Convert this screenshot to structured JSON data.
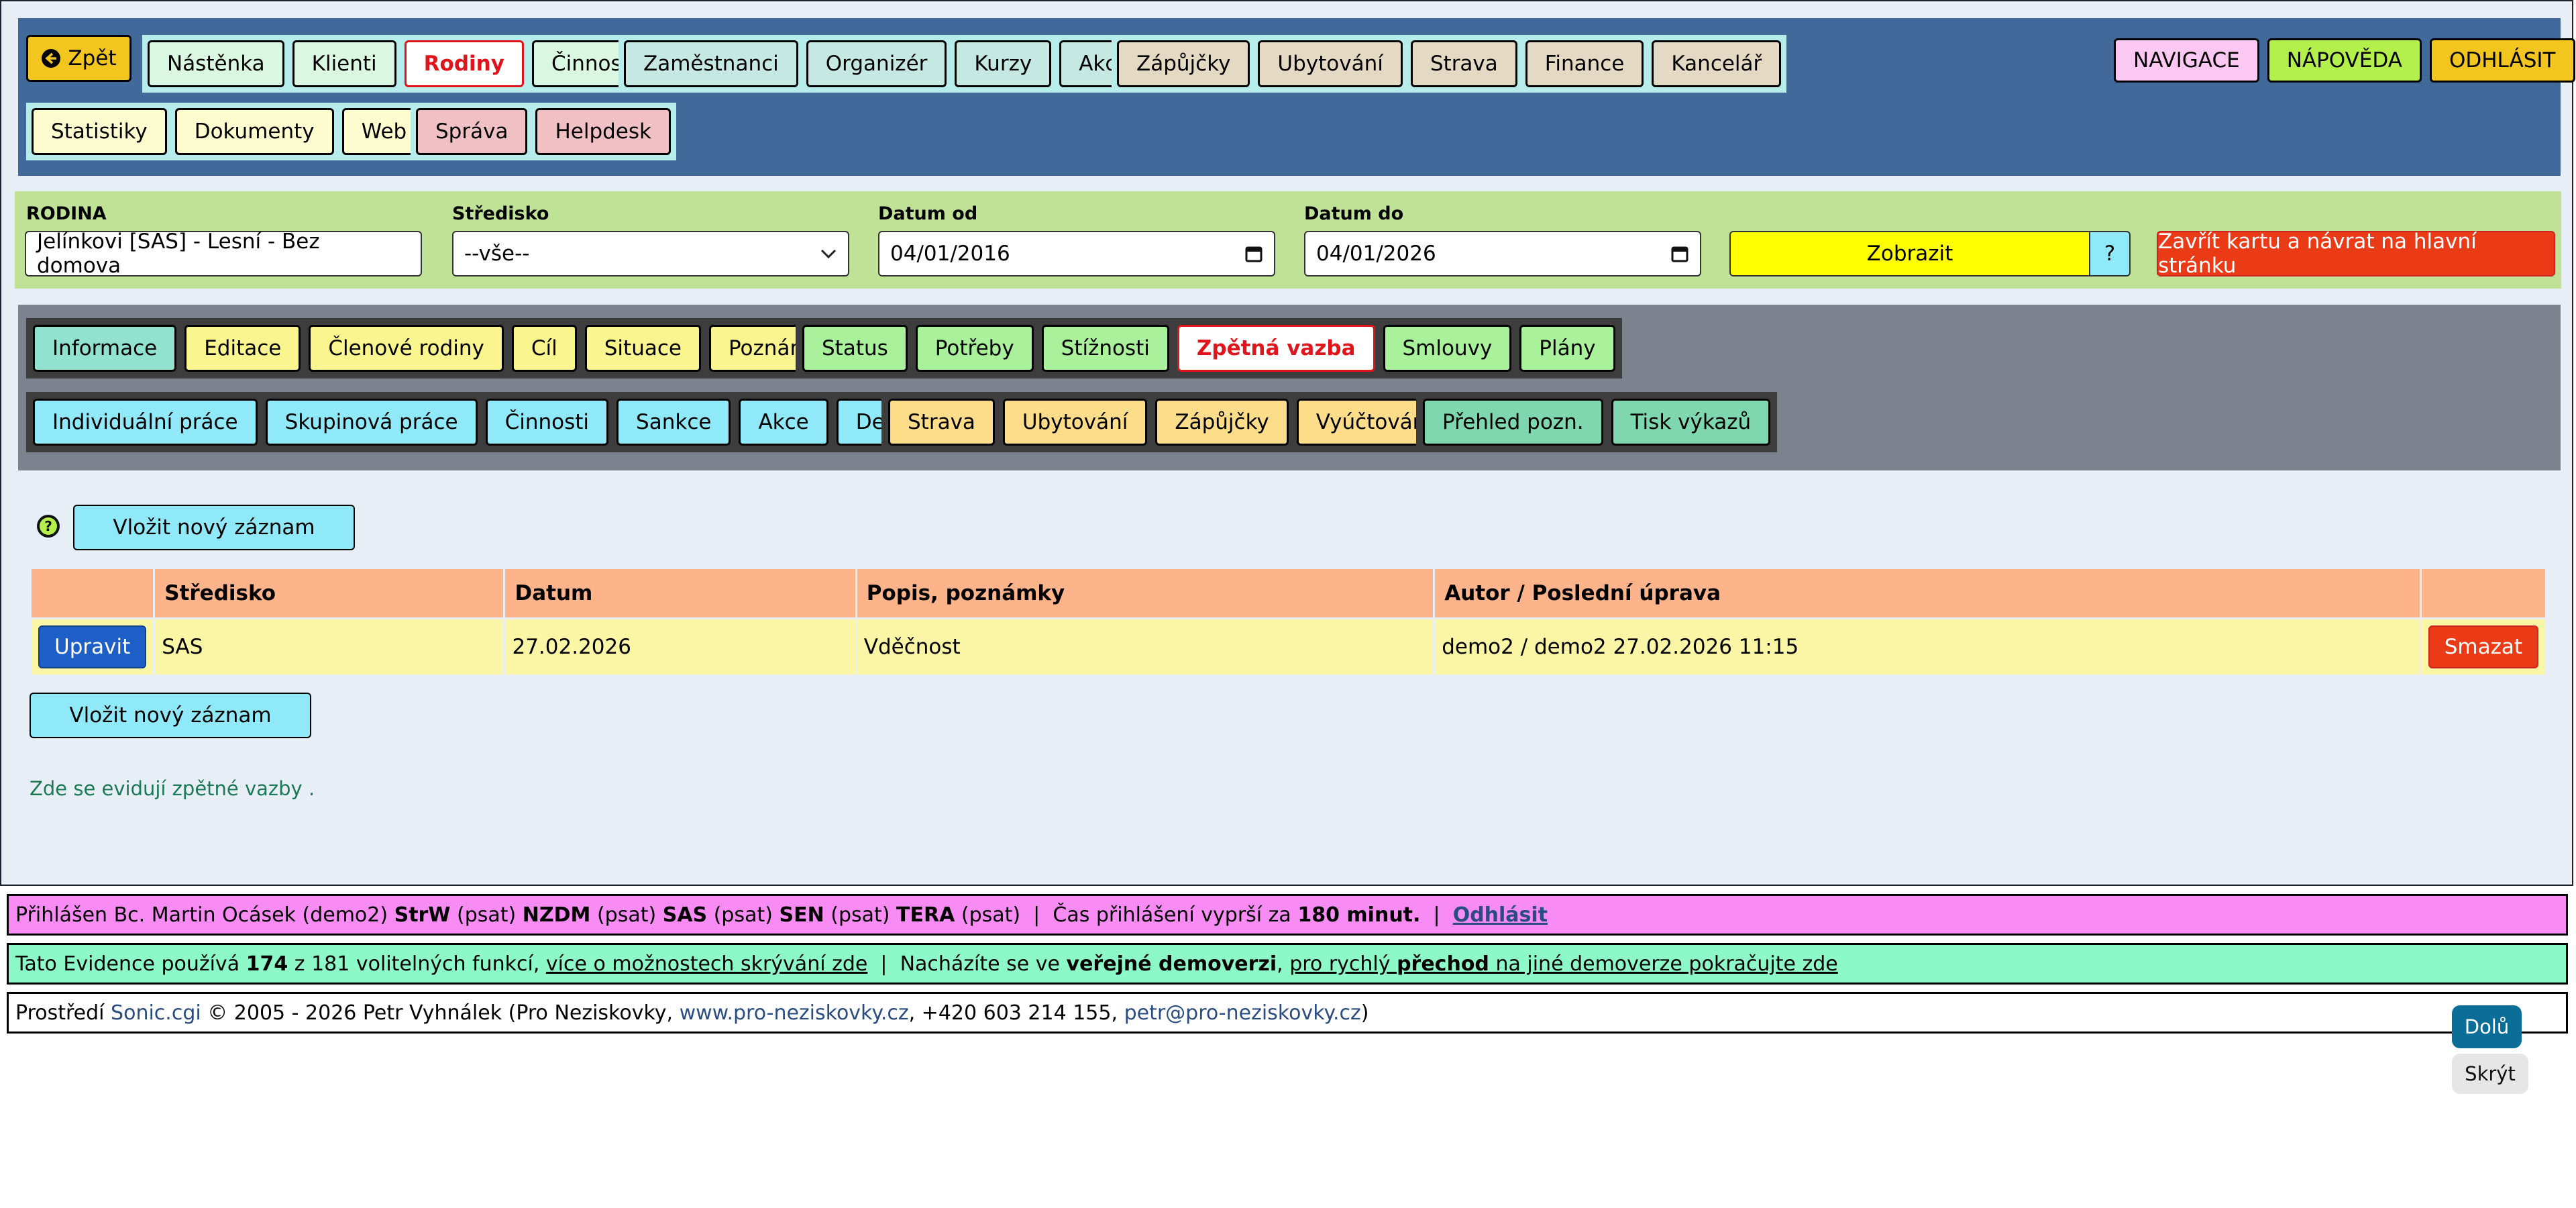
{
  "colors": {
    "nav_bg": "#41699a",
    "filter_bg": "#bfe297",
    "subnav_bg": "#7c828e",
    "active_red": "#e0151b"
  },
  "nav": {
    "back": {
      "icon": "arrow-left-circle-icon",
      "label": "Zpět"
    },
    "group1": [
      "Nástěnka",
      "Klienti",
      "Rodiny",
      "Činnosti"
    ],
    "group2": [
      "Zaměstnanci",
      "Organizér",
      "Kurzy",
      "Akce"
    ],
    "group3": [
      "Zápůjčky",
      "Ubytování",
      "Strava",
      "Finance",
      "Kancelář"
    ],
    "group4": [
      "Statistiky",
      "Dokumenty",
      "Web"
    ],
    "group5": [
      "Správa",
      "Helpdesk"
    ],
    "right": [
      "NAVIGACE",
      "NÁPOVĚDA",
      "ODHLÁSIT"
    ]
  },
  "filter": {
    "rodina_label": "RODINA",
    "rodina_value": "Jelínkovi [SAS] - Lesní - Bez domova",
    "stredisko_label": "Středisko",
    "stredisko_value": "--vše--",
    "datum_od_label": "Datum od",
    "datum_od_value": "04/01/2016",
    "datum_do_label": "Datum do",
    "datum_do_value": "04/01/2026",
    "zobrazit": "Zobrazit",
    "help": "?",
    "close": "Zavřít kartu a návrat na hlavní stránku"
  },
  "subnav": {
    "g1": [
      "Informace",
      "Editace",
      "Členové rodiny",
      "Cíl",
      "Situace",
      "Poznámky"
    ],
    "g2": [
      "Status",
      "Potřeby",
      "Stížnosti",
      "Zpětná vazba",
      "Smlouvy",
      "Plány"
    ],
    "g3": [
      "Individuální práce",
      "Skupinová práce",
      "Činnosti",
      "Sankce",
      "Akce",
      "Deníky"
    ],
    "g4": [
      "Strava",
      "Ubytování",
      "Zápůjčky",
      "Vyúčtování"
    ],
    "g5": [
      "Přehled pozn.",
      "Tisk výkazů"
    ]
  },
  "content": {
    "help_icon": "question-circle-icon",
    "insert_label": "Vložit nový záznam",
    "columns": [
      "",
      "Středisko",
      "Datum",
      "Popis, poznámky",
      "Autor / Poslední úprava",
      ""
    ],
    "rows": [
      {
        "edit": "Upravit",
        "stredisko": "SAS",
        "datum": "27.02.2026",
        "popis": "Vděčnost",
        "autor": "demo2 / demo2 27.02.2026 11:15",
        "delete": "Smazat"
      }
    ],
    "note": "Zde se evidují zpětné vazby ."
  },
  "footer": {
    "login_prefix": "Přihlášen Bc. Martin Ocásek (demo2)",
    "roles": [
      [
        "StrW",
        "(psat)"
      ],
      [
        "NZDM",
        "(psat)"
      ],
      [
        "SAS",
        "(psat)"
      ],
      [
        "SEN",
        "(psat)"
      ],
      [
        "TERA",
        "(psat)"
      ]
    ],
    "expire_text": "Čas přihlášení vyprší za",
    "expire_value": "180 minut.",
    "logout": "Odhlásit",
    "uses_prefix": "Tato Evidence používá",
    "uses_count": "174",
    "uses_suffix": "z 181 volitelných funkcí,",
    "uses_link": "více o možnostech skrývání zde",
    "demo_prefix": "Nacházíte se ve",
    "demo_bold": "veřejné demoverzi",
    "demo_link_a": "pro rychlý",
    "demo_link_b": "přechod",
    "demo_link_c": "na jiné demoverze pokračujte zde",
    "env_prefix": "Prostředí",
    "env_link": "Sonic.cgi",
    "env_text": "© 2005 - 2026 Petr Vyhnálek (Pro Neziskovky,",
    "env_web": "www.pro-neziskovky.cz",
    "env_phone": ", +420 603 214 155,",
    "env_mail": "petr@pro-neziskovky.cz",
    "env_end": ")"
  },
  "float": {
    "down": "Dolů",
    "hide": "Skrýt"
  }
}
